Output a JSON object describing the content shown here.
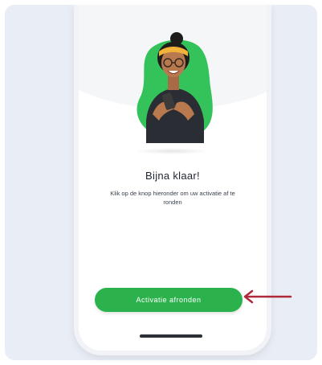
{
  "screen": {
    "title": "Bijna klaar!",
    "subtitle": "Klik op de knop hieronder om uw activatie af te ronden",
    "button_label": "Activatie afronden"
  },
  "colors": {
    "accent_green": "#2bb24c",
    "arrow_red": "#b0293a",
    "card_bg": "#e9edf5"
  },
  "icons": {
    "illustration": "woman-with-phone-illustration",
    "arrow": "arrow-left-icon"
  }
}
